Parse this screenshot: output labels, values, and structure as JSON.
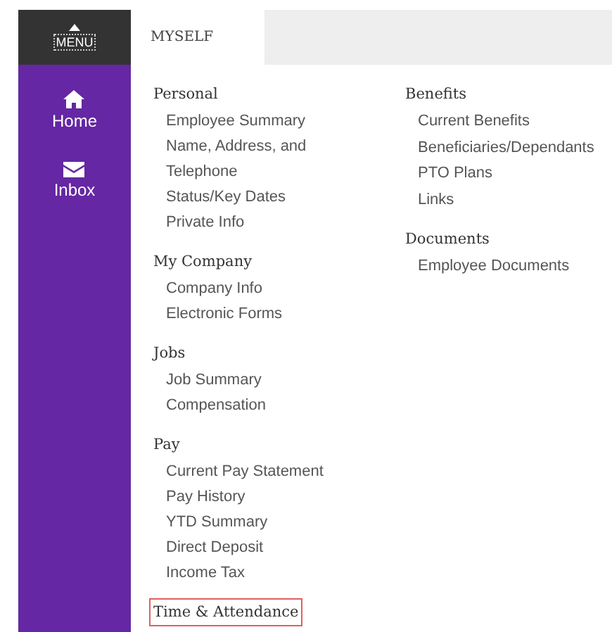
{
  "menu_button": {
    "label": "MENU"
  },
  "nav": [
    {
      "label": "Home",
      "kind": "home",
      "selected": false
    },
    {
      "label": "Inbox",
      "kind": "inbox",
      "selected": false
    }
  ],
  "tabs": [
    {
      "label": "MYSELF",
      "selected": true
    }
  ],
  "columns": [
    {
      "sections": [
        {
          "heading": "Personal",
          "highlighted": false,
          "items": [
            "Employee Summary",
            "Name, Address, and Telephone",
            "Status/Key Dates",
            "Private Info"
          ]
        },
        {
          "heading": "My Company",
          "highlighted": false,
          "items": [
            "Company Info",
            "Electronic Forms"
          ]
        },
        {
          "heading": "Jobs",
          "highlighted": false,
          "items": [
            "Job Summary",
            "Compensation"
          ]
        },
        {
          "heading": "Pay",
          "highlighted": false,
          "items": [
            "Current Pay Statement",
            "Pay History",
            "YTD Summary",
            "Direct Deposit",
            "Income Tax"
          ]
        },
        {
          "heading": "Time & Attendance",
          "highlighted": true
        }
      ]
    },
    {
      "sections": [
        {
          "heading": "Benefits",
          "highlighted": false,
          "items": [
            "Current Benefits",
            "Beneficiaries/Dependants",
            "PTO Plans",
            "Links"
          ]
        },
        {
          "heading": "Documents",
          "highlighted": false,
          "items": [
            "Employee Documents"
          ]
        }
      ]
    }
  ]
}
